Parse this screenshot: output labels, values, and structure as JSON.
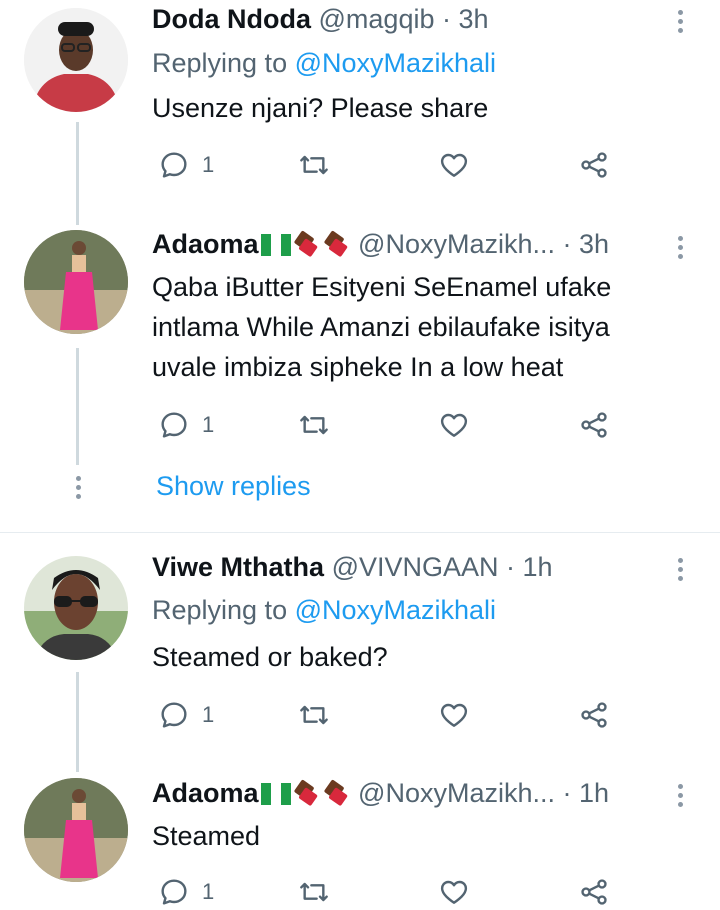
{
  "tweets": [
    {
      "name": "Doda Ndoda",
      "handle": "@magqib",
      "time": "· 3h",
      "replying_prefix": "Replying to ",
      "replying_to": "@NoxyMazikhali",
      "text": "Usenze njani? Please share",
      "reply_count": "1"
    },
    {
      "name": "Adaoma",
      "name_emojis": [
        "nigeria-flag",
        "chocolate-bar",
        "chocolate-bar"
      ],
      "handle": "@NoxyMazikh...",
      "time": "· 3h",
      "text_lines": [
        "Qaba iButter Esityeni SeEnamel ufake",
        "intlama While Amanzi ebilaufake isitya",
        "uvale imbiza sipheke In a low heat"
      ],
      "reply_count": "1"
    },
    {
      "name": "Viwe Mthatha",
      "handle": "@VIVNGAAN",
      "time": "· 1h",
      "replying_prefix": "Replying to ",
      "replying_to": "@NoxyMazikhali",
      "text": "Steamed or baked?",
      "reply_count": "1"
    },
    {
      "name": "Adaoma",
      "name_emojis": [
        "nigeria-flag",
        "chocolate-bar",
        "chocolate-bar"
      ],
      "handle": "@NoxyMazikh...",
      "time": "· 1h",
      "text": "Steamed",
      "reply_count": "1"
    }
  ],
  "show_replies_label": "Show replies",
  "colors": {
    "accent": "#1d9bf0",
    "secondary_text": "#536471",
    "thread_line": "#cfd9de"
  }
}
